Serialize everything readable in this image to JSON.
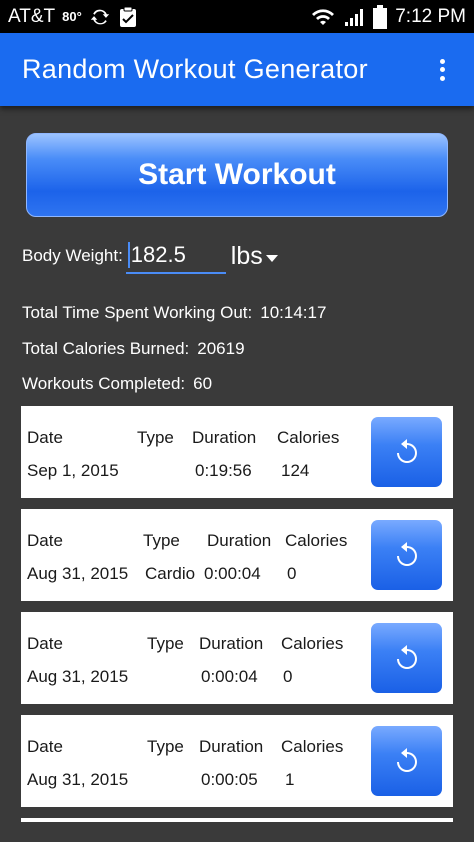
{
  "status_bar": {
    "carrier": "AT&T",
    "temperature": "80°",
    "time": "7:12 PM",
    "icons": [
      "sync-icon",
      "clipboard-icon",
      "wifi-icon",
      "signal-icon",
      "battery-icon"
    ]
  },
  "app_bar": {
    "title": "Random Workout Generator",
    "menu_icon": "overflow-menu-icon"
  },
  "start_button": {
    "label": "Start Workout"
  },
  "body_weight": {
    "label": "Body Weight:",
    "value": "182.5",
    "unit": "lbs"
  },
  "stats": {
    "time_label": "Total Time Spent Working Out:",
    "time_value": "10:14:17",
    "calories_label": "Total Calories Burned:",
    "calories_value": "20619",
    "workouts_label": "Workouts Completed:",
    "workouts_value": "60"
  },
  "columns": {
    "date": "Date",
    "type": "Type",
    "duration": "Duration",
    "calories": "Calories"
  },
  "workouts": [
    {
      "date": "Sep 1, 2015",
      "type": "",
      "duration": "0:19:56",
      "calories": "124"
    },
    {
      "date": "Aug 31, 2015",
      "type": "Cardio",
      "duration": "0:00:04",
      "calories": "0"
    },
    {
      "date": "Aug 31, 2015",
      "type": "",
      "duration": "0:00:04",
      "calories": "0"
    },
    {
      "date": "Aug 31, 2015",
      "type": "",
      "duration": "0:00:05",
      "calories": "1"
    }
  ],
  "colors": {
    "app_bar": "#1a6bf0",
    "background": "#3a3a3a",
    "accent": "#4a8cf6"
  }
}
